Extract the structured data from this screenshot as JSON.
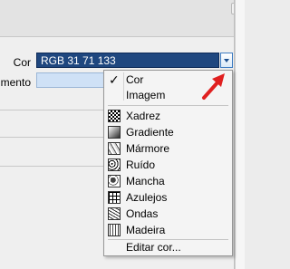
{
  "form": {
    "label_cor": "Cor",
    "label_partial": "mento",
    "color_value": "RGB 31 71 133"
  },
  "colors": {
    "field_bg": "#1f477f",
    "arrow": "#e02020"
  },
  "menu": {
    "selected": {
      "label": "Cor",
      "checked": true
    },
    "image": "Imagem",
    "patterns": [
      {
        "label": "Xadrez",
        "icon": "checkerboard-icon"
      },
      {
        "label": "Gradiente",
        "icon": "gradient-icon"
      },
      {
        "label": "Mármore",
        "icon": "marble-icon"
      },
      {
        "label": "Ruído",
        "icon": "noise-icon"
      },
      {
        "label": "Mancha",
        "icon": "stain-icon"
      },
      {
        "label": "Azulejos",
        "icon": "tiles-icon"
      },
      {
        "label": "Ondas",
        "icon": "waves-icon"
      },
      {
        "label": "Madeira",
        "icon": "wood-icon"
      }
    ],
    "edit": "Editar cor..."
  }
}
